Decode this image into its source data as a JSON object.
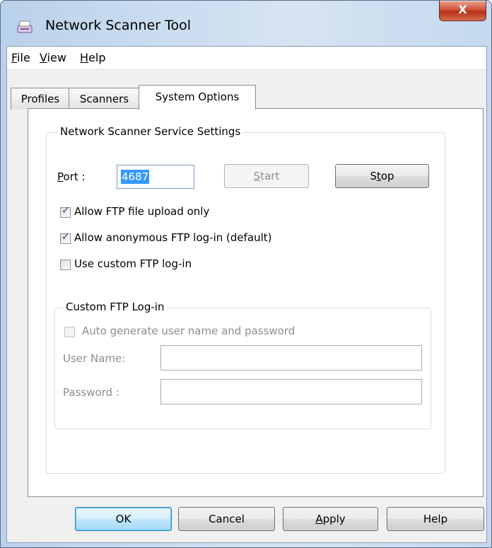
{
  "window": {
    "title": "Network Scanner Tool",
    "close_label": "X"
  },
  "menu": [
    {
      "label": "File"
    },
    {
      "label": "View"
    },
    {
      "label": "Help"
    }
  ],
  "tabs": [
    {
      "label": "Profiles",
      "active": false
    },
    {
      "label": "Scanners",
      "active": false
    },
    {
      "label": "System Options",
      "active": true
    }
  ],
  "service": {
    "group_title": "Network Scanner Service Settings",
    "port_label": "Port :",
    "port_value": "4687",
    "start_label": "Start",
    "stop_label": "Stop",
    "options": [
      {
        "label": "Allow FTP file upload only",
        "checked": true
      },
      {
        "label": "Allow anonymous FTP log-in (default)",
        "checked": true
      },
      {
        "label": "Use custom FTP log-in",
        "checked": false
      }
    ]
  },
  "custom_login": {
    "group_title": "Custom FTP Log-in",
    "auto_label": "Auto generate user name and password",
    "user_label": "User Name:",
    "user_value": "",
    "password_label": "Password :",
    "password_value": ""
  },
  "buttons": {
    "ok": "OK",
    "cancel": "Cancel",
    "apply": "Apply",
    "help": "Help"
  }
}
